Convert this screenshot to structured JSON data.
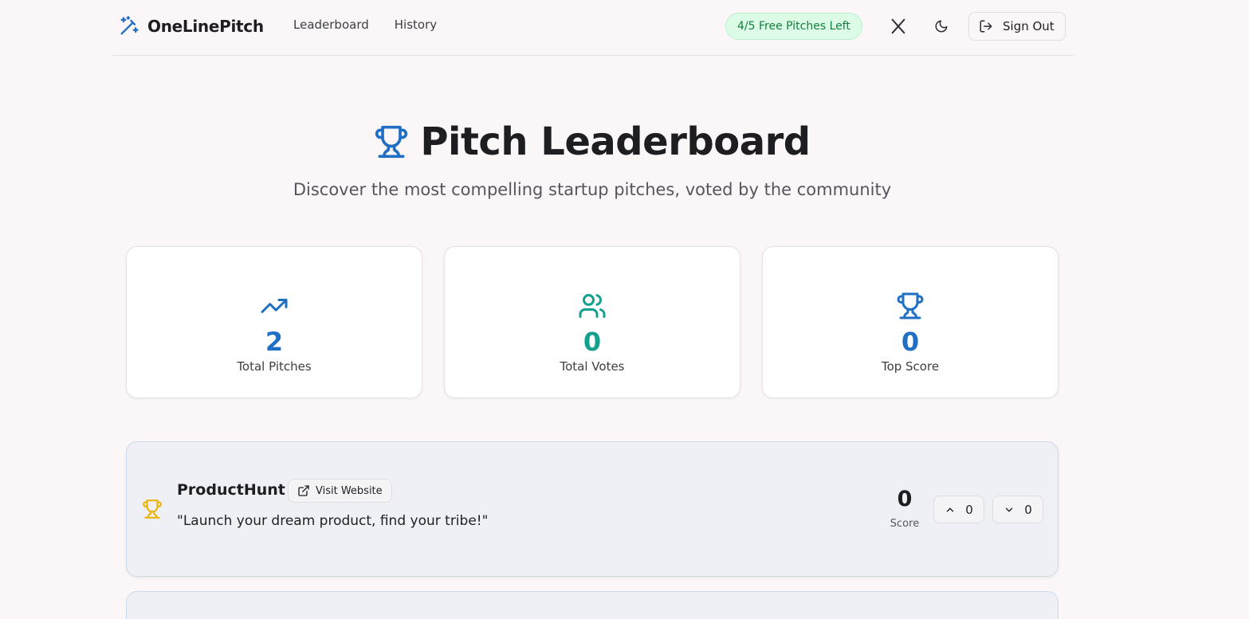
{
  "header": {
    "brand": "OneLinePitch",
    "nav": [
      "Leaderboard",
      "History"
    ],
    "badge": "4/5 Free Pitches Left",
    "sign_out": "Sign Out"
  },
  "hero": {
    "title": "Pitch Leaderboard",
    "subtitle": "Discover the most compelling startup pitches, voted by the community"
  },
  "stats": [
    {
      "icon": "trending-up-icon",
      "value": "2",
      "label": "Total Pitches",
      "color": "#1f6fc5"
    },
    {
      "icon": "users-icon",
      "value": "0",
      "label": "Total Votes",
      "color": "#14a08f"
    },
    {
      "icon": "trophy-icon",
      "value": "0",
      "label": "Top Score",
      "color": "#1f6fc5"
    }
  ],
  "pitches": [
    {
      "name": "ProductHunt",
      "visit_label": "Visit Website",
      "quote": "\"Launch your dream product, find your tribe!\"",
      "score": "0",
      "score_label": "Score",
      "upvotes": "0",
      "downvotes": "0"
    }
  ],
  "colors": {
    "accent": "#1f6fc5",
    "teal": "#14a08f",
    "gold": "#eab308",
    "badge_bg": "#dcfce7",
    "badge_text": "#15803d"
  }
}
